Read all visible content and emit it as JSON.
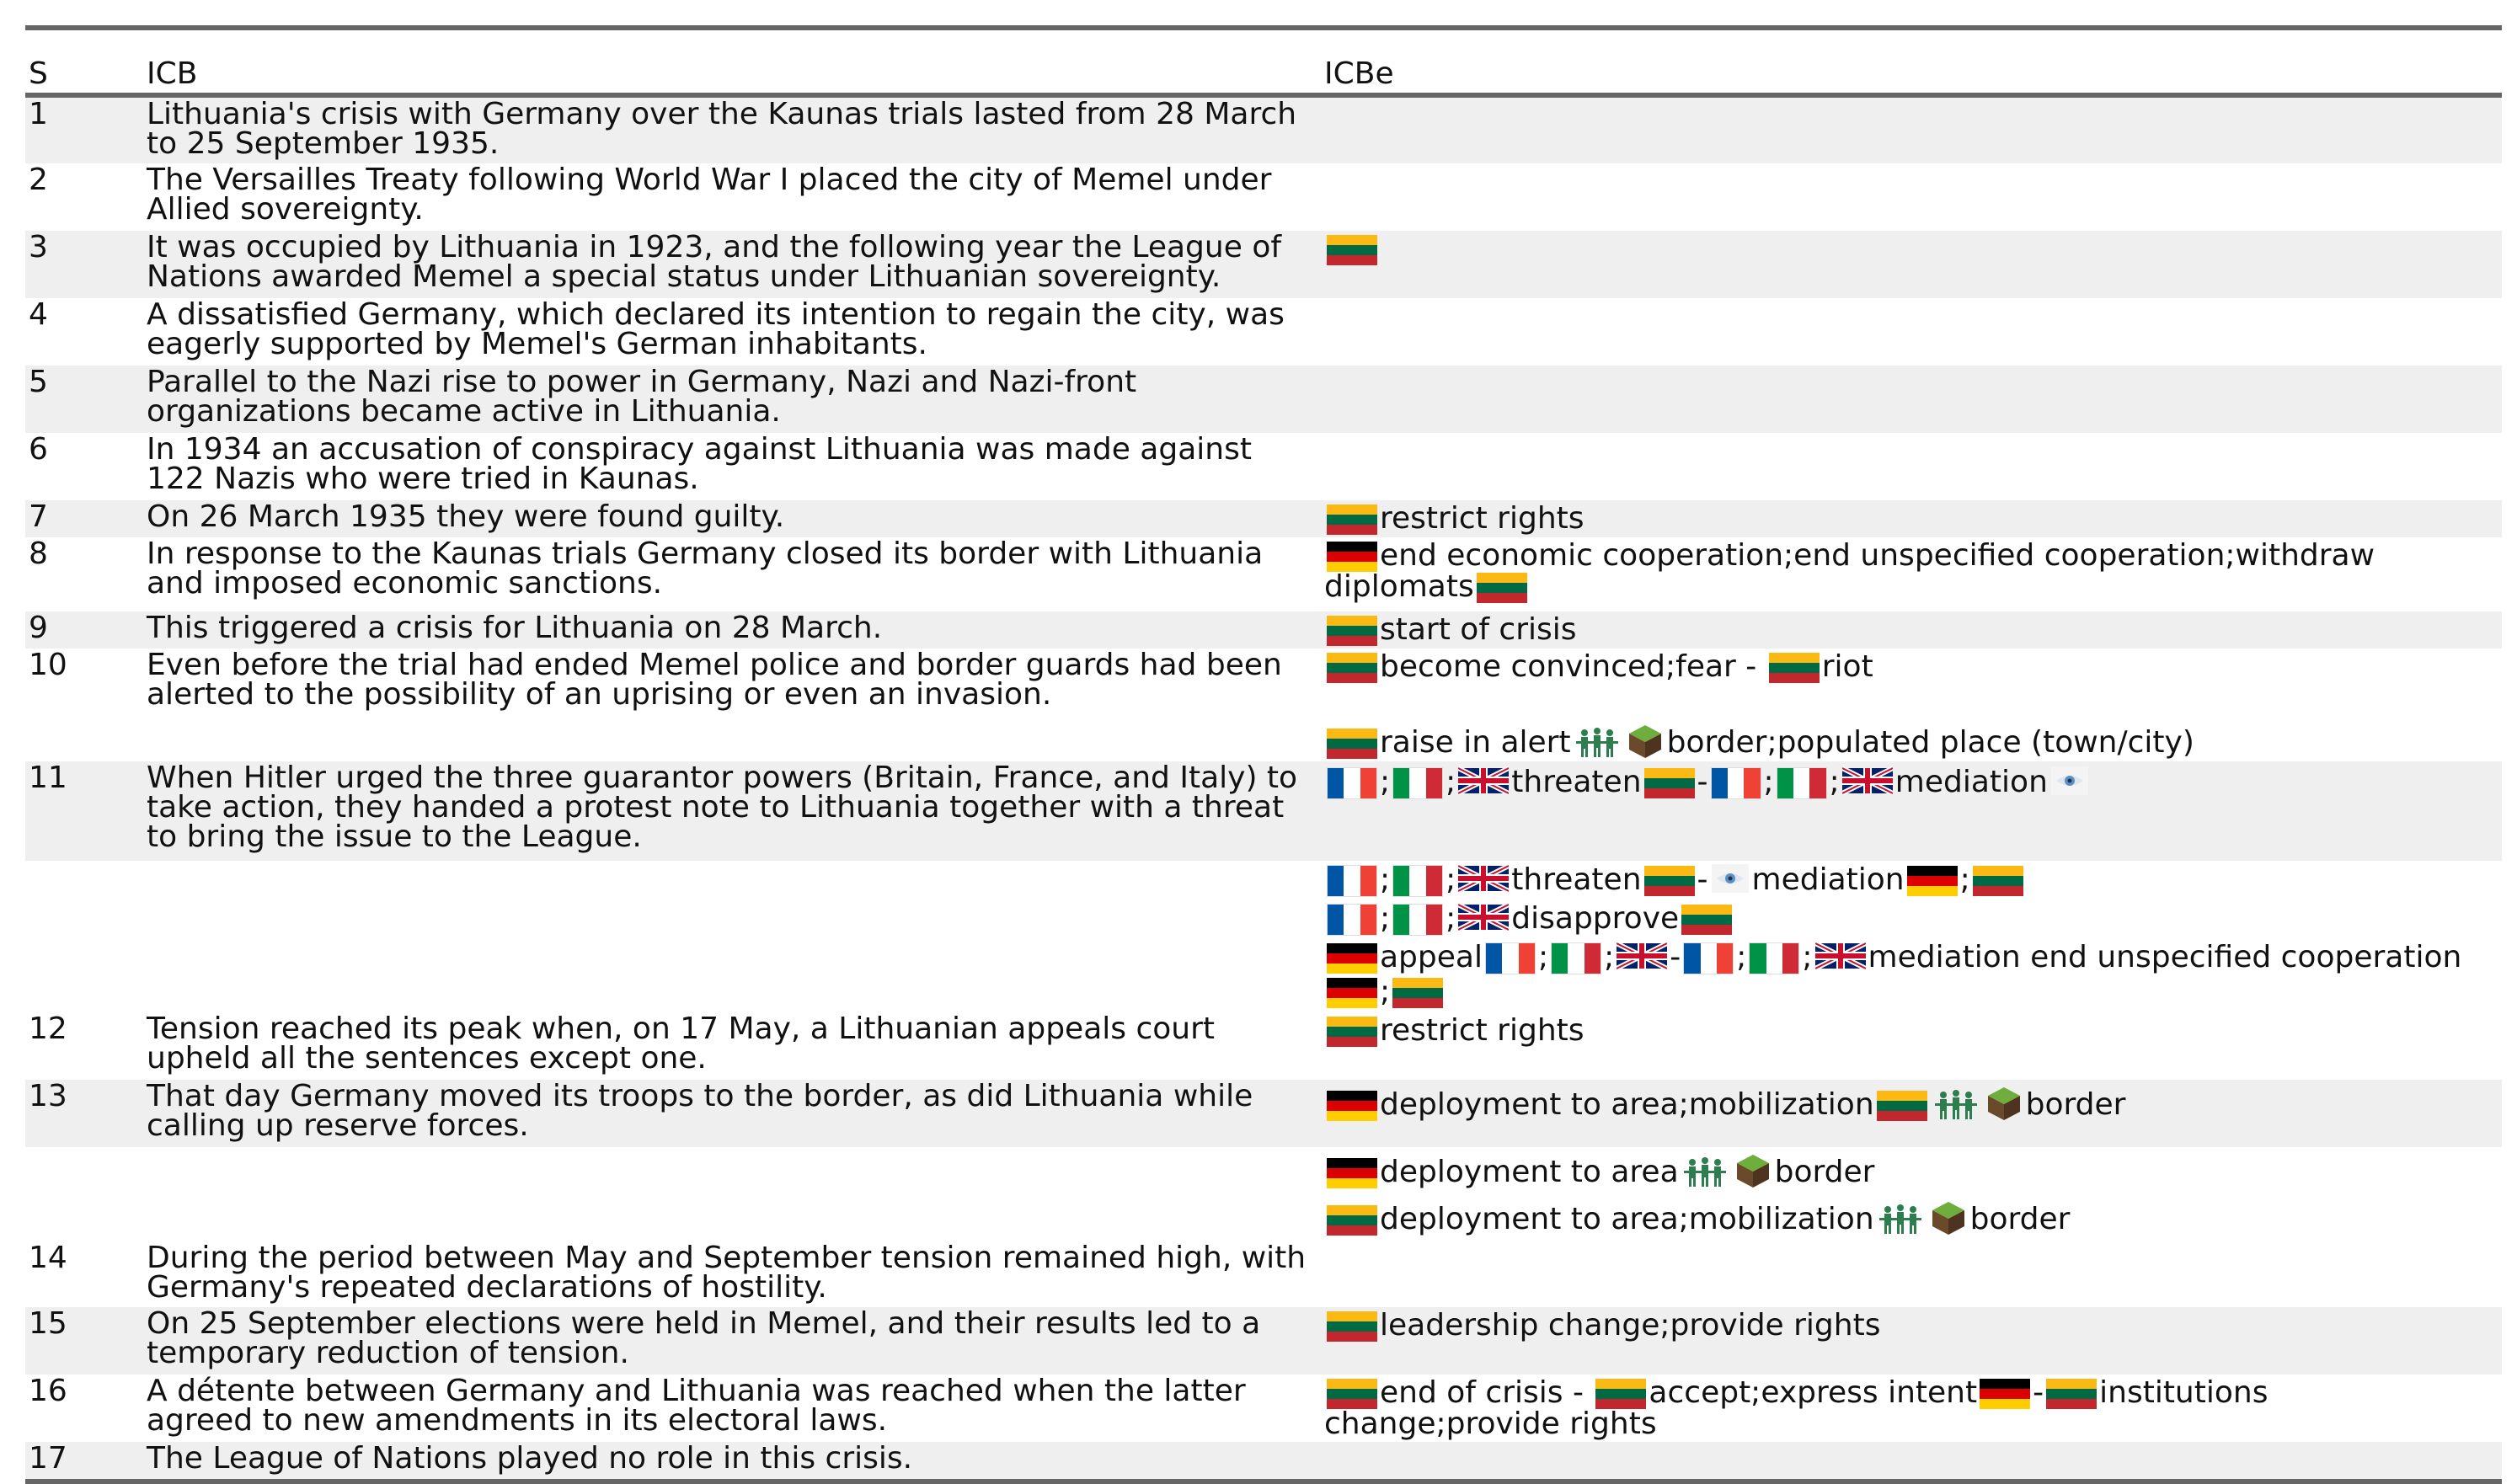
{
  "header": {
    "s": "S",
    "icb": "ICB",
    "icbe": "ICBe"
  },
  "colors": {
    "lithuania": [
      "#fdb913",
      "#006a44",
      "#c1272d"
    ],
    "germany": [
      "#000000",
      "#dd0000",
      "#ffce00"
    ],
    "france": [
      "#0055a4",
      "#ffffff",
      "#ef4135"
    ],
    "italy": [
      "#009246",
      "#ffffff",
      "#ce2b37"
    ],
    "shade": "#efefef",
    "rule": "#666666"
  },
  "icons": {
    "military": "soldiers-icon",
    "border": "terrain-cube-icon",
    "mediator": "eye-icon"
  },
  "rows": [
    {
      "s": "1",
      "icb": "Lithuania's crisis with Germany over the Kaunas trials lasted from 28 March\nto 25 September 1935."
    },
    {
      "s": "2",
      "icb": "The Versailles Treaty following World War I placed the city of Memel under\nAllied sovereignty."
    },
    {
      "s": "3",
      "icb": "It was occupied by Lithuania in 1923, and the following year the League of\nNations awarded Memel a special status under Lithuanian sovereignty."
    },
    {
      "s": "4",
      "icb": "A dissatisfied Germany, which declared its intention to regain the city, was\neagerly supported by Memel's German inhabitants."
    },
    {
      "s": "5",
      "icb": "Parallel to the Nazi rise to power in Germany, Nazi and Nazi-front\norganizations became active in Lithuania."
    },
    {
      "s": "6",
      "icb": "In 1934 an accusation of conspiracy against Lithuania was made against\n122 Nazis who were tried in Kaunas."
    },
    {
      "s": "7",
      "icb": "On 26 March 1935 they were found guilty."
    },
    {
      "s": "8",
      "icb": "In response to the Kaunas trials Germany closed its border with Lithuania\nand imposed economic sanctions."
    },
    {
      "s": "9",
      "icb": "This triggered a crisis for Lithuania on 28 March."
    },
    {
      "s": "10",
      "icb": "Even before the trial had ended Memel police and border guards had been\nalerted to the possibility of an uprising or even an invasion."
    },
    {
      "s": "11",
      "icb": "When Hitler urged the three guarantor powers (Britain, France, and Italy) to\ntake action, they handed a protest note to Lithuania together with a threat\nto bring the issue to the League."
    },
    {
      "s": "",
      "icb": ""
    },
    {
      "s": "12",
      "icb": "Tension reached its peak when, on 17 May, a Lithuanian appeals court\nupheld all the sentences except one."
    },
    {
      "s": "13",
      "icb": "That day Germany moved its troops to the border, as did Lithuania while\ncalling up reserve forces."
    },
    {
      "s": "",
      "icb": ""
    },
    {
      "s": "14",
      "icb": "During the period between May and September tension remained high, with\nGermany's repeated declarations of hostility."
    },
    {
      "s": "15",
      "icb": "On 25 September elections were held in Memel, and their results led to a\ntemporary reduction of tension."
    },
    {
      "s": "16",
      "icb": "A détente between Germany and Lithuania was reached when the latter\nagreed to new amendments in its electoral laws."
    },
    {
      "s": "17",
      "icb": "The League of Nations played no role in this crisis."
    }
  ],
  "events": {
    "e7": "restrict rights",
    "e8a": "end economic cooperation;end unspecified cooperation;withdraw",
    "e8b": "diplomats",
    "e9": "start of crisis",
    "e10a1": "become convinced;fear",
    "e10a2": "riot",
    "e10b1": "raise in alert",
    "e10b2": "border;populated place (town/city)",
    "e11a1": "threaten",
    "e11a2": "mediation",
    "e11b1": "threaten",
    "e11b2": "mediation",
    "e11c1": "disapprove",
    "e11d1": "appeal",
    "e11d2": "mediation end unspecified cooperation",
    "e12": "restrict rights",
    "e13a1": "deployment to area;mobilization",
    "e13a2": "border",
    "e13b1": "deployment to area",
    "e13b2": "border",
    "e13c1": "deployment to area;mobilization",
    "e13c2": "border",
    "e15": "leadership change;provide rights",
    "e16a": "end of crisis",
    "e16b": "accept;express intent",
    "e16c": "institutions",
    "e16d": "change;provide rights",
    "dash": "-",
    "semi": ";"
  }
}
